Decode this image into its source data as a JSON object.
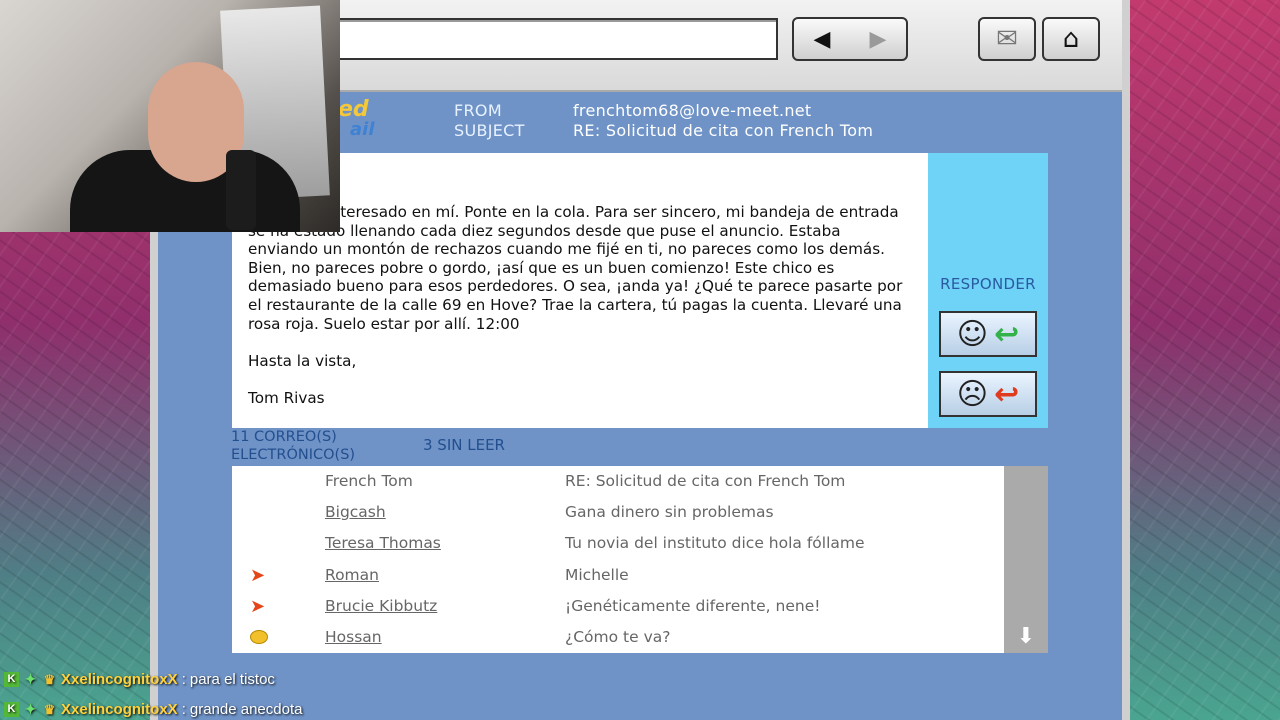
{
  "colors": {
    "window_bg": "#6f93c7",
    "reply_panel": "#6fd3f8",
    "label_text": "#234f8f",
    "chat_user": "#ffd23c"
  },
  "toolbar": {
    "back_icon": "◀",
    "forward_icon": "▶",
    "mail_icon": "✉",
    "home_icon": "⌂"
  },
  "email": {
    "logo_top": "ed",
    "logo_bottom": "ail",
    "from_label": "FROM",
    "subject_label": "SUBJECT",
    "from_value": "frenchtom68@love-meet.net",
    "subject_value": "RE: Solicitud de cita con French Tom",
    "body": [
      "e estabas interesado en mí. Ponte en la cola. Para ser sincero, mi bandeja de entrada se ha estado llenando cada diez segundos desde que puse el anuncio. Estaba enviando un montón de rechazos cuando me fijé en ti, no pareces como los demás. Bien, no pareces pobre o gordo, ¡así que es un buen comienzo! Este chico es demasiado bueno para esos perdedores. O sea, ¡anda ya! ¿Qué te parece pasarte por el restaurante de la calle 69 en Hove? Trae la cartera, tú pagas la cuenta. Llevaré una rosa roja. Suelo estar por allí. 12:00",
      "Hasta la vista,",
      "Tom Rivas"
    ],
    "reply_label": "RESPONDER",
    "reply_positive_face": "☺",
    "reply_negative_face": "☹",
    "reply_arrow": "↩"
  },
  "inbox": {
    "total": "11 CORREO(S) ELECTRÓNICO(S)",
    "unread": "3 SIN LEER",
    "scroll_down_icon": "⬇",
    "rows": [
      {
        "flag": "",
        "sender": "French Tom",
        "subject": "RE: Solicitud de cita con French Tom",
        "unread": false
      },
      {
        "flag": "",
        "sender": "Bigcash",
        "subject": "Gana dinero sin problemas",
        "unread": true
      },
      {
        "flag": "",
        "sender": "Teresa Thomas",
        "subject": "Tu novia del instituto dice hola fóllame",
        "unread": true
      },
      {
        "flag": "arrow",
        "sender": "Roman",
        "subject": "Michelle",
        "unread": true
      },
      {
        "flag": "arrow",
        "sender": "Brucie Kibbutz",
        "subject": "¡Genéticamente diferente, nene!",
        "unread": true
      },
      {
        "flag": "dot",
        "sender": "Hossan",
        "subject": "¿Cómo te va?",
        "unread": true
      }
    ]
  },
  "chat": [
    {
      "user": "XxelincognitoxX",
      "sep": " : ",
      "message": "para el tistoc"
    },
    {
      "user": "XxelincognitoxX",
      "sep": " : ",
      "message": "grande anecdota"
    }
  ]
}
